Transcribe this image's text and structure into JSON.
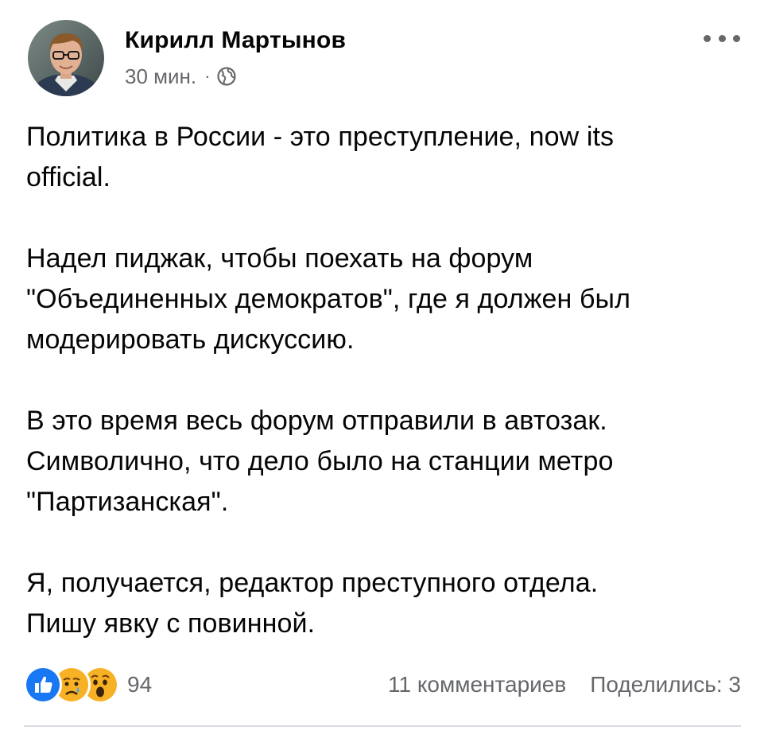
{
  "post": {
    "author": "Кирилл Мартынов",
    "time": "30 мин.",
    "separator": "·",
    "privacy_icon": "globe-icon",
    "more_icon": "more-horizontal-icon",
    "paragraphs": [
      "Политика в России - это преступление, now its\nofficial.",
      "Надел пиджак, чтобы поехать на форум\n\"Объединенных демократов\", где я должен был\nмодерировать дискуссию.",
      "В это время весь форум отправили в автозак.\nСимволично, что дело было на станции метро\n\"Партизанская\".",
      "Я, получается, редактор преступного отдела.\nПишу явку с повинной."
    ]
  },
  "footer": {
    "reactions": [
      "like-icon",
      "sad-icon",
      "wow-icon"
    ],
    "reaction_count": "94",
    "comments": "11 комментариев",
    "shares": "Поделились: 3"
  },
  "colors": {
    "text": "#050505",
    "secondary": "#65676b",
    "like_blue": "#1877f2",
    "emoji_yellow": "#f7b125",
    "divider": "#dadde1"
  }
}
